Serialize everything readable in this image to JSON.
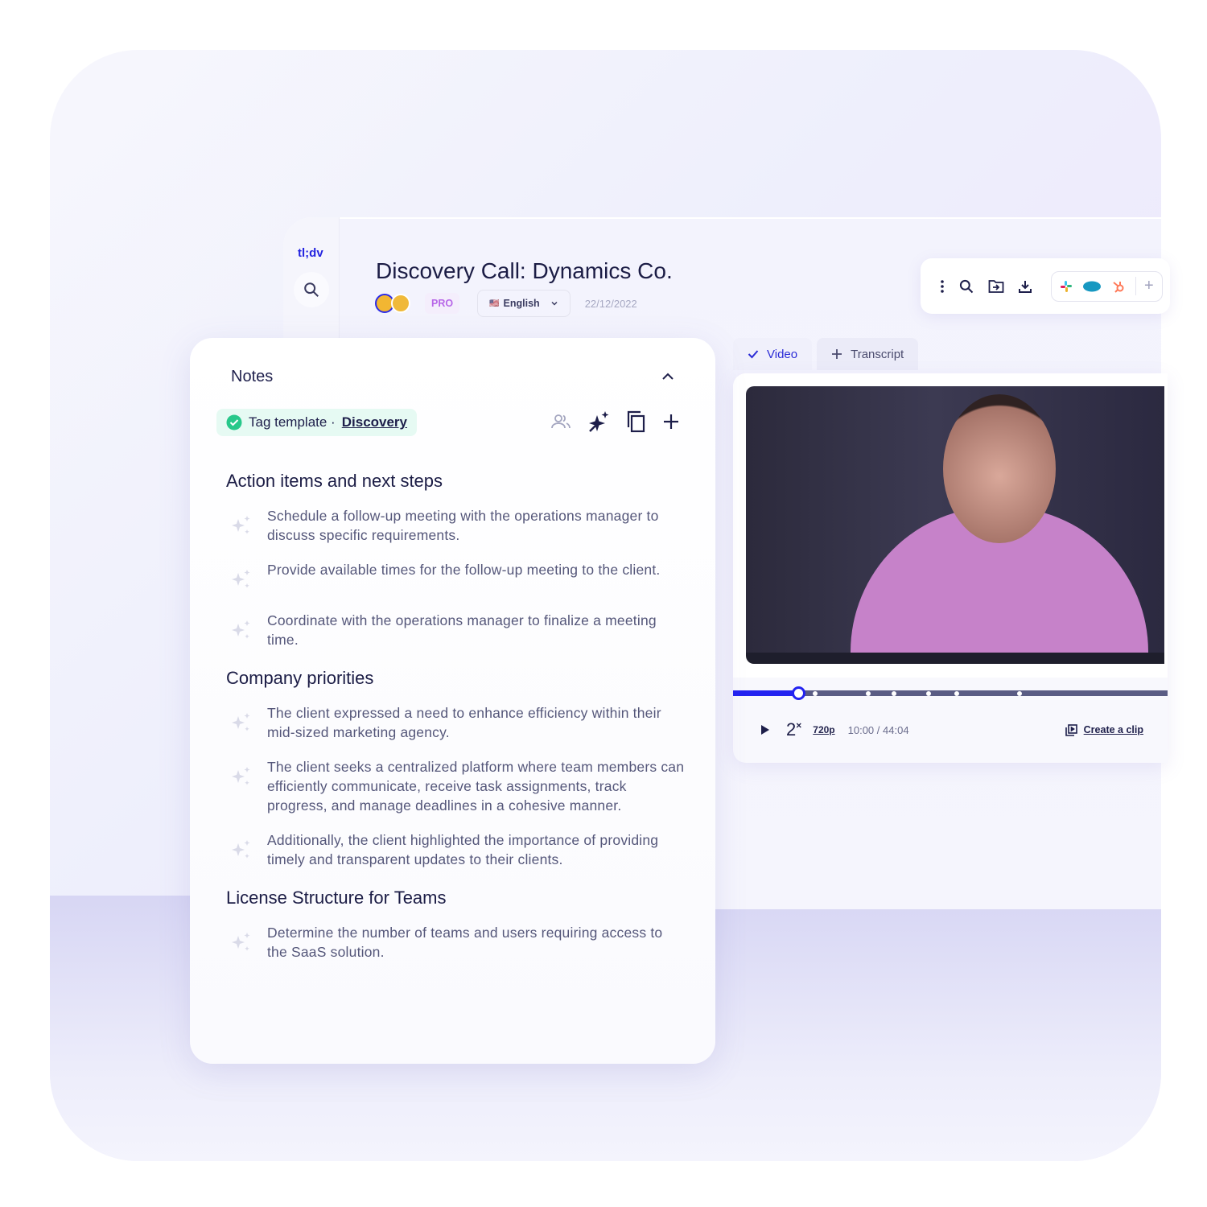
{
  "app": {
    "logo": "tl;dv"
  },
  "meeting": {
    "title": "Discovery Call: Dynamics Co.",
    "plan_badge": "PRO",
    "language": "English",
    "date": "22/12/2022"
  },
  "toolbar": {
    "icons": [
      "more-vertical-icon",
      "search-icon",
      "move-to-folder-icon",
      "download-icon",
      "slack-icon",
      "salesforce-icon",
      "hubspot-icon",
      "plus-icon"
    ]
  },
  "tabs": [
    {
      "label": "Video",
      "active": true
    },
    {
      "label": "Transcript",
      "active": false
    }
  ],
  "player": {
    "speed": "2",
    "speed_suffix": "×",
    "quality": "720p",
    "current_time": "10:00",
    "duration": "44:04",
    "time_separator": " / ",
    "progress_fraction": 0.15,
    "create_clip_label": "Create a clip",
    "accent": "#2323f0"
  },
  "notes": {
    "heading": "Notes",
    "tag_label": "Tag template ·",
    "tag_link": "Discovery",
    "sections": [
      {
        "title": "Action items and next steps",
        "items": [
          "Schedule a follow-up meeting with the operations manager to discuss specific requirements.",
          "Provide available times for the follow-up meeting to the client.",
          "Coordinate with the operations manager to finalize a meeting time."
        ]
      },
      {
        "title": "Company priorities",
        "items": [
          "The client expressed a need to enhance efficiency within their mid-sized marketing agency.",
          "The client seeks a centralized platform where team members can efficiently communicate, receive task assignments, track progress, and manage deadlines in a cohesive manner.",
          "Additionally, the client highlighted the importance of providing timely and transparent updates to their clients."
        ]
      },
      {
        "title": "License Structure for Teams",
        "items": [
          "Determine the number of teams and users requiring access to the SaaS solution."
        ]
      }
    ]
  }
}
